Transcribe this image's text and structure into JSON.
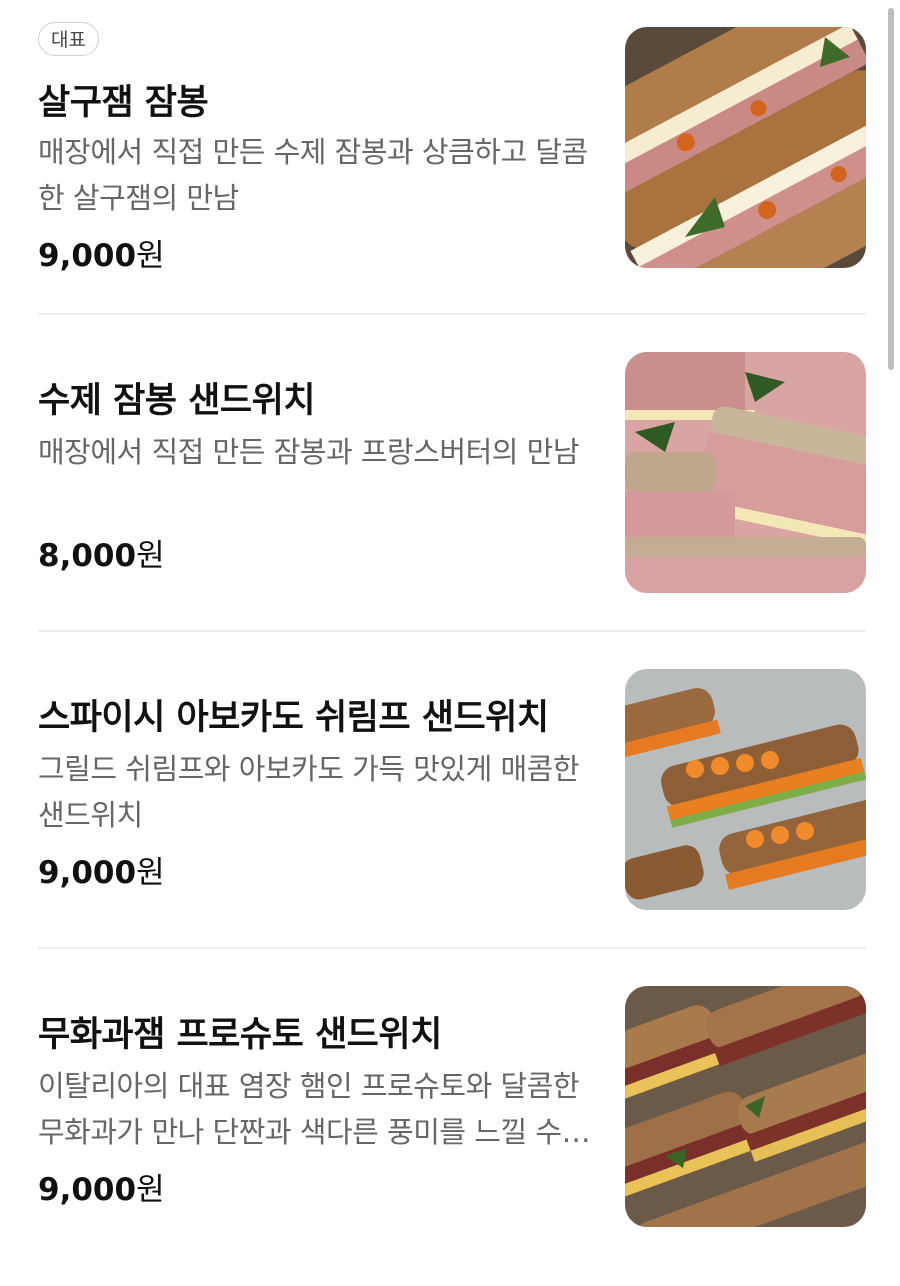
{
  "menu": {
    "items": [
      {
        "badge": "대표",
        "name": "살구잼 잠봉",
        "description": "매장에서 직접 만든 수제 잠봉과 상큼하고 달콤한 살구잼의 만남",
        "price_number": "9,000",
        "price_unit": "원",
        "image_icon": "sandwich-photo"
      },
      {
        "name": "수제 잠봉 샌드위치",
        "description": "매장에서 직접 만든 잠봉과 프랑스버터의 만남",
        "price_number": "8,000",
        "price_unit": "원",
        "image_icon": "sandwich-photo"
      },
      {
        "name": "스파이시 아보카도 쉬림프 샌드위치",
        "description": "그릴드 쉬림프와 아보카도 가득 맛있게 매콤한 샌드위치",
        "price_number": "9,000",
        "price_unit": "원",
        "image_icon": "sandwich-photo"
      },
      {
        "name": "무화과잼 프로슈토 샌드위치",
        "description": "이탈리아의 대표 염장 햄인 프로슈토와 달콤한 무화과가 만나 단짠과 색다른 풍미를 느낄 수 있는 샌드위치",
        "price_number": "9,000",
        "price_unit": "원",
        "image_icon": "sandwich-photo"
      }
    ]
  },
  "colors": {
    "text_primary": "#111111",
    "text_secondary": "#666666",
    "divider": "#ececec",
    "badge_border": "#cfcfcf"
  }
}
